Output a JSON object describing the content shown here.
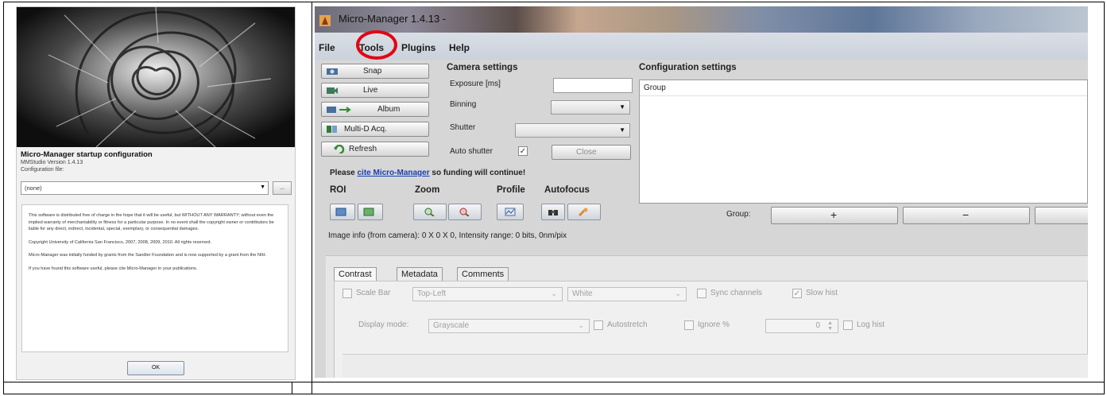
{
  "startup": {
    "title": "Micro-Manager startup configuration",
    "version": "MMStudio Version 1.4.13",
    "config_label": "Configuration file:",
    "config_value": "(none)",
    "browse_label": "...",
    "paragraphs": [
      "This software is distributed free of charge in the hope that it will be useful, but WITHOUT ANY WARRANTY; without even the implied warranty of merchantability or fitness for a particular purpose. In no event shall the copyright owner or contributors be liable for any direct, indirect, incidental, special, exemplary, or consequential damages.",
      "Copyright University of California San Francisco, 2007, 2008, 2009, 2010. All rights reserved.",
      "Micro-Manager was initially funded by grants from the Sandler Foundation and is now supported by a grant from the NIH.",
      "If you have found this software useful, please cite Micro-Manager in your publications."
    ],
    "ok_label": "OK"
  },
  "window": {
    "title": "Micro-Manager 1.4.13 -",
    "menu": [
      "File",
      "Tools",
      "Plugins",
      "Help"
    ],
    "highlighted_menu": "Tools",
    "highlight_color": "#e30613"
  },
  "buttons": {
    "snap": "Snap",
    "live": "Live",
    "album": "Album",
    "mda": "Multi-D Acq.",
    "refresh": "Refresh"
  },
  "camera": {
    "heading": "Camera settings",
    "exposure_label": "Exposure [ms]",
    "exposure_value": "",
    "binning_label": "Binning",
    "binning_value": "",
    "shutter_label": "Shutter",
    "shutter_value": "",
    "auto_shutter_label": "Auto shutter",
    "auto_shutter_checked": true,
    "close_label": "Close"
  },
  "configuration": {
    "heading": "Configuration settings",
    "column": "Group",
    "group_label": "Group:",
    "add": "+",
    "remove": "−"
  },
  "cite": {
    "before": "Please ",
    "link": "cite Micro-Manager",
    "after": " so funding will continue!"
  },
  "tools": {
    "roi": "ROI",
    "zoom": "Zoom",
    "profile": "Profile",
    "autofocus": "Autofocus"
  },
  "image_info": "Image info (from camera): 0 X 0 X 0, Intensity range: 0 bits, 0nm/pix",
  "tabs": [
    "Contrast",
    "Metadata",
    "Comments"
  ],
  "contrast": {
    "scale_bar": "Scale Bar",
    "position": "Top-Left",
    "color": "White",
    "sync_channels": "Sync channels",
    "slow_hist": "Slow hist",
    "display_mode_label": "Display mode:",
    "display_mode_value": "Grayscale",
    "autostretch": "Autostretch",
    "ignore_pct": "Ignore %",
    "ignore_value": "0",
    "log_hist": "Log hist"
  }
}
